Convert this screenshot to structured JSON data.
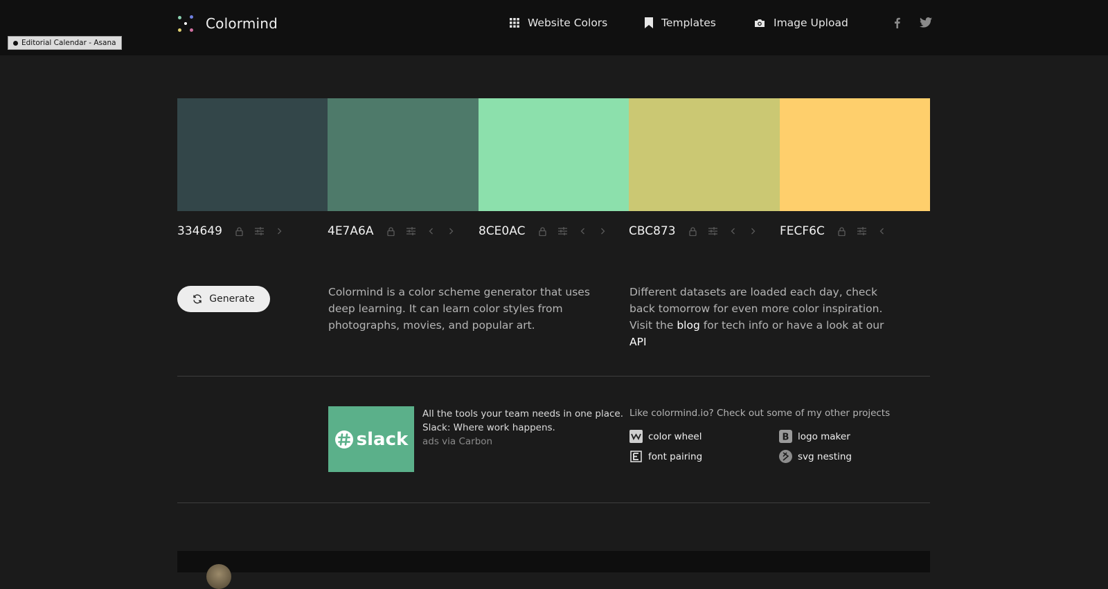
{
  "header": {
    "brand": "Colormind",
    "nav": [
      {
        "label": "Website Colors",
        "icon": "grid-icon"
      },
      {
        "label": "Templates",
        "icon": "bookmark-icon"
      },
      {
        "label": "Image Upload",
        "icon": "camera-icon"
      }
    ],
    "social": [
      "facebook-icon",
      "twitter-icon"
    ]
  },
  "tooltip": {
    "text": "Editorial Calendar - Asana"
  },
  "palette": [
    {
      "hex": "334649",
      "color": "#334649"
    },
    {
      "hex": "4E7A6A",
      "color": "#4E7A6A"
    },
    {
      "hex": "8CE0AC",
      "color": "#8CE0AC"
    },
    {
      "hex": "CBC873",
      "color": "#CBC873"
    },
    {
      "hex": "FECF6C",
      "color": "#FECF6C"
    }
  ],
  "generate": {
    "label": "Generate"
  },
  "description": {
    "left": "Colormind is a color scheme generator that uses deep learning. It can learn color styles from photographs, movies, and popular art.",
    "right_prefix": "Different datasets are loaded each day, check back tomorrow for even more color inspiration. Visit the",
    "blog_link": "blog",
    "right_middle": "for tech info or have a look at our",
    "api_link": "API"
  },
  "ad": {
    "logo_text": "slack",
    "line1": "All the tools your team needs in one place.",
    "line2": "Slack: Where work happens.",
    "via": "ads via Carbon"
  },
  "projects": {
    "title": "Like colormind.io? Check out some of my other projects",
    "items": [
      {
        "label": "color wheel",
        "icon": "color-wheel-icon"
      },
      {
        "label": "logo maker",
        "icon": "logo-maker-icon"
      },
      {
        "label": "font pairing",
        "icon": "font-pairing-icon"
      },
      {
        "label": "svg nesting",
        "icon": "svg-nesting-icon"
      }
    ]
  },
  "colors": {
    "topbar": "#101010",
    "page": "#1b1b1b",
    "ad_bg": "#5bb08a"
  }
}
